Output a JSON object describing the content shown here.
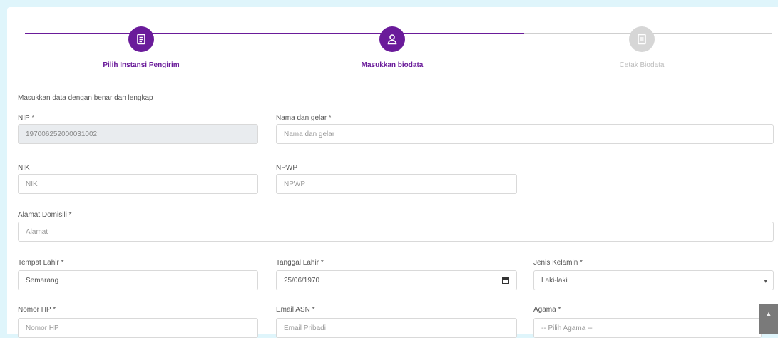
{
  "stepper": {
    "steps": [
      {
        "label": "Pilih Instansi Pengirim",
        "icon": "document-icon",
        "state": "completed"
      },
      {
        "label": "Masukkan biodata",
        "icon": "user-icon",
        "state": "active"
      },
      {
        "label": "Cetak Biodata",
        "icon": "print-icon",
        "state": "inactive"
      }
    ],
    "accent_color": "#6a1b9a"
  },
  "form": {
    "intro": "Masukkan data dengan benar dan lengkap",
    "nip": {
      "label": "NIP *",
      "value": "197006252000031002"
    },
    "nama": {
      "label": "Nama dan gelar *",
      "placeholder": "Nama dan gelar"
    },
    "nik": {
      "label": "NIK",
      "placeholder": "NIK"
    },
    "npwp": {
      "label": "NPWP",
      "placeholder": "NPWP"
    },
    "alamat": {
      "label": "Alamat Domisili *",
      "placeholder": "Alamat"
    },
    "tempat_lahir": {
      "label": "Tempat Lahir *",
      "value": "Semarang"
    },
    "tanggal_lahir": {
      "label": "Tanggal Lahir *",
      "value": "25/06/1970"
    },
    "jenis_kelamin": {
      "label": "Jenis Kelamin *",
      "value": "Laki-laki"
    },
    "nomor_hp": {
      "label": "Nomor HP *",
      "placeholder": "Nomor HP"
    },
    "email": {
      "label": "Email ASN *",
      "placeholder": "Email Pribadi"
    },
    "agama": {
      "label": "Agama *",
      "value": "-- Pilih Agama --"
    }
  }
}
